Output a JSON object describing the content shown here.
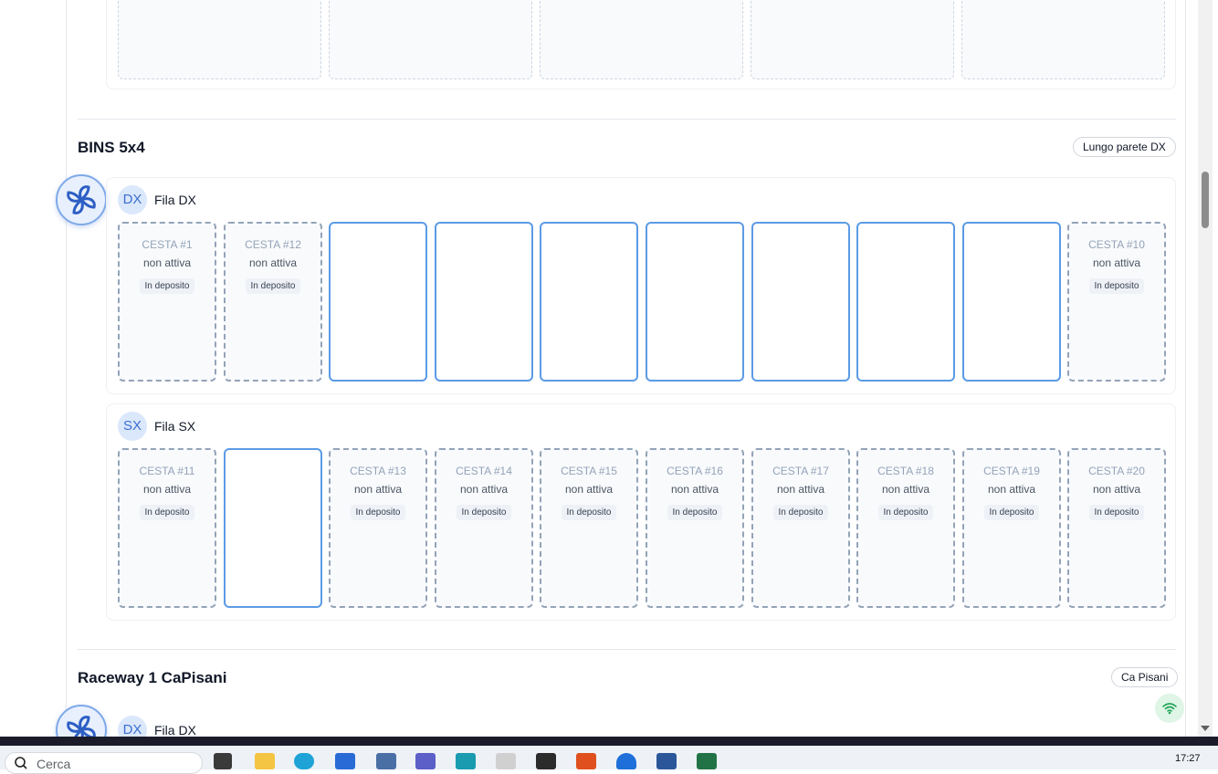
{
  "top_group": {
    "slots": 5
  },
  "sections": [
    {
      "title": "BINS 5x4",
      "tag": "Lungo parete DX",
      "rows": [
        {
          "badge": "DX",
          "label": "Fila DX",
          "bins": [
            {
              "name": "CESTA #1",
              "status": "non attiva",
              "badge": "In deposito",
              "active": false
            },
            {
              "name": "CESTA #12",
              "status": "non attiva",
              "badge": "In deposito",
              "active": false
            },
            {
              "active": true
            },
            {
              "active": true
            },
            {
              "active": true
            },
            {
              "active": true
            },
            {
              "active": true
            },
            {
              "active": true
            },
            {
              "active": true
            },
            {
              "name": "CESTA #10",
              "status": "non attiva",
              "badge": "In deposito",
              "active": false
            }
          ]
        },
        {
          "badge": "SX",
          "label": "Fila SX",
          "bins": [
            {
              "name": "CESTA #11",
              "status": "non attiva",
              "badge": "In deposito",
              "active": false
            },
            {
              "active": true
            },
            {
              "name": "CESTA #13",
              "status": "non attiva",
              "badge": "In deposito",
              "active": false
            },
            {
              "name": "CESTA #14",
              "status": "non attiva",
              "badge": "In deposito",
              "active": false
            },
            {
              "name": "CESTA #15",
              "status": "non attiva",
              "badge": "In deposito",
              "active": false
            },
            {
              "name": "CESTA #16",
              "status": "non attiva",
              "badge": "In deposito",
              "active": false
            },
            {
              "name": "CESTA #17",
              "status": "non attiva",
              "badge": "In deposito",
              "active": false
            },
            {
              "name": "CESTA #18",
              "status": "non attiva",
              "badge": "In deposito",
              "active": false
            },
            {
              "name": "CESTA #19",
              "status": "non attiva",
              "badge": "In deposito",
              "active": false
            },
            {
              "name": "CESTA #20",
              "status": "non attiva",
              "badge": "In deposito",
              "active": false
            }
          ]
        }
      ]
    },
    {
      "title": "Raceway 1 CaPisani",
      "tag": "Ca Pisani",
      "rows": [
        {
          "badge": "DX",
          "label": "Fila DX"
        }
      ]
    }
  ],
  "taskbar": {
    "search_placeholder": "Cerca",
    "clock": "17:27",
    "apps": [
      "task-view-icon",
      "file-explorer-icon",
      "edge-icon",
      "store-icon",
      "calculator-icon",
      "teams-icon",
      "app-icon",
      "snipping-icon",
      "app-p-icon",
      "app-orange-icon",
      "onedrive-icon",
      "word-icon",
      "excel-icon"
    ]
  },
  "colors": {
    "accent": "#5b9be6",
    "inactive_border": "#94a3b8",
    "badge_bg": "#dbe7fb",
    "wifi_bg": "#dff5e6"
  }
}
